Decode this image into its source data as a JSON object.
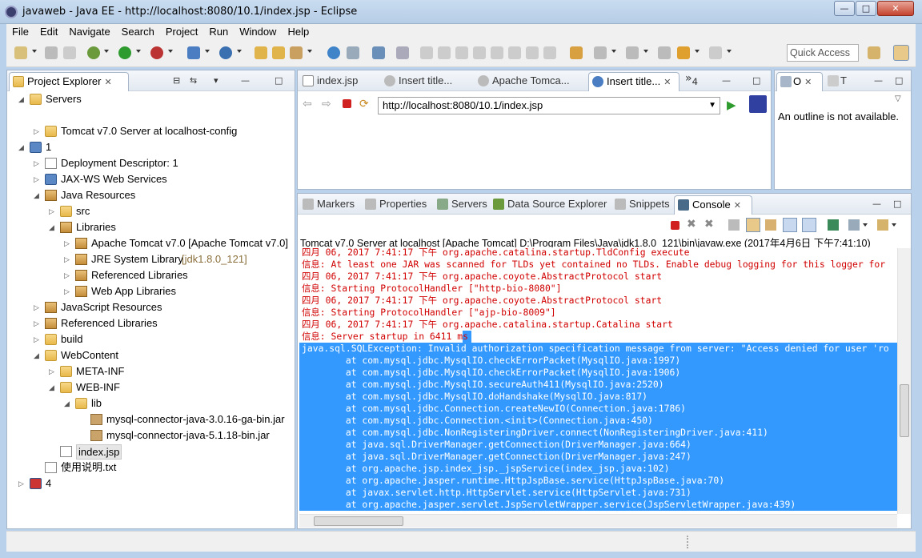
{
  "window": {
    "title": "javaweb - Java EE - http://localhost:8080/10.1/index.jsp - Eclipse",
    "min_label": "—",
    "max_label": "□",
    "close_label": "✕"
  },
  "menubar": [
    "File",
    "Edit",
    "Navigate",
    "Search",
    "Project",
    "Run",
    "Window",
    "Help"
  ],
  "toolbar": {
    "quick_access_placeholder": "Quick Access"
  },
  "project_explorer": {
    "tab_label": "Project Explorer",
    "tree": [
      {
        "label": "Servers",
        "indent": 0,
        "expanded": true,
        "icon": "folder-icon"
      },
      {
        "label": "",
        "indent": 1,
        "expanded": null,
        "icon": ""
      },
      {
        "label": "Tomcat v7.0 Server at localhost-config",
        "indent": 1,
        "expanded": false,
        "icon": "folder-icon"
      },
      {
        "label": "1",
        "indent": 0,
        "expanded": true,
        "icon": "project-icon"
      },
      {
        "label": "Deployment Descriptor: 1",
        "indent": 1,
        "expanded": false,
        "icon": "descriptor-icon"
      },
      {
        "label": "JAX-WS Web Services",
        "indent": 1,
        "expanded": false,
        "icon": "webservice-icon"
      },
      {
        "label": "Java Resources",
        "indent": 1,
        "expanded": true,
        "icon": "java-resources-icon"
      },
      {
        "label": "src",
        "indent": 2,
        "expanded": false,
        "icon": "package-folder-icon"
      },
      {
        "label": "Libraries",
        "indent": 2,
        "expanded": true,
        "icon": "libraries-icon"
      },
      {
        "label": "Apache Tomcat v7.0 [Apache Tomcat v7.0]",
        "indent": 3,
        "expanded": false,
        "icon": "library-icon"
      },
      {
        "label": "JRE System Library ",
        "suffix": "[jdk1.8.0_121]",
        "indent": 3,
        "expanded": false,
        "icon": "library-icon"
      },
      {
        "label": "Referenced Libraries",
        "indent": 3,
        "expanded": false,
        "icon": "library-icon"
      },
      {
        "label": "Web App Libraries",
        "indent": 3,
        "expanded": false,
        "icon": "library-icon"
      },
      {
        "label": "JavaScript Resources",
        "indent": 1,
        "expanded": false,
        "icon": "js-resources-icon"
      },
      {
        "label": "Referenced Libraries",
        "indent": 1,
        "expanded": false,
        "icon": "library-icon"
      },
      {
        "label": "build",
        "indent": 1,
        "expanded": false,
        "icon": "folder-icon"
      },
      {
        "label": "WebContent",
        "indent": 1,
        "expanded": true,
        "icon": "folder-icon"
      },
      {
        "label": "META-INF",
        "indent": 2,
        "expanded": false,
        "icon": "folder-icon"
      },
      {
        "label": "WEB-INF",
        "indent": 2,
        "expanded": true,
        "icon": "folder-icon"
      },
      {
        "label": "lib",
        "indent": 3,
        "expanded": true,
        "icon": "folder-icon"
      },
      {
        "label": "mysql-connector-java-3.0.16-ga-bin.jar",
        "indent": 4,
        "expanded": null,
        "icon": "jar-icon"
      },
      {
        "label": "mysql-connector-java-5.1.18-bin.jar",
        "indent": 4,
        "expanded": null,
        "icon": "jar-icon"
      },
      {
        "label": "index.jsp",
        "indent": 2,
        "expanded": null,
        "icon": "jsp-file-icon",
        "selected": true
      },
      {
        "label": "使用说明.txt",
        "indent": 1,
        "expanded": null,
        "icon": "text-file-icon"
      },
      {
        "label": "4",
        "indent": 0,
        "expanded": false,
        "icon": "project-error-icon"
      }
    ]
  },
  "editor": {
    "tabs": [
      {
        "label": "index.jsp",
        "active": false
      },
      {
        "label": "Insert title...",
        "active": false
      },
      {
        "label": "Apache Tomca...",
        "active": false
      },
      {
        "label": "Insert title...",
        "active": true
      }
    ],
    "overflow_label": "»",
    "overflow_count": "4",
    "url": "http://localhost:8080/10.1/index.jsp"
  },
  "outline": {
    "tab_label": "O",
    "tab2_label": "T",
    "message": "An outline is not available."
  },
  "bottom_panel": {
    "tabs": [
      "Markers",
      "Properties",
      "Servers",
      "Data Source Explorer",
      "Snippets",
      "Console"
    ],
    "active_tab": "Console",
    "console_header": "Tomcat v7.0 Server at localhost [Apache Tomcat] D:\\Program Files\\Java\\jdk1.8.0_121\\bin\\javaw.exe (2017年4月6日 下午7:41:10)",
    "lines": [
      {
        "text": "四月 06, 2017 7:41:17 下午 org.apache.catalina.startup.TldConfig execute",
        "selected": false
      },
      {
        "text": "信息: At least one JAR was scanned for TLDs yet contained no TLDs. Enable debug logging for this logger for",
        "selected": false
      },
      {
        "text": "四月 06, 2017 7:41:17 下午 org.apache.coyote.AbstractProtocol start",
        "selected": false
      },
      {
        "text": "信息: Starting ProtocolHandler [\"http-bio-8080\"]",
        "selected": false
      },
      {
        "text": "四月 06, 2017 7:41:17 下午 org.apache.coyote.AbstractProtocol start",
        "selected": false
      },
      {
        "text": "信息: Starting ProtocolHandler [\"ajp-bio-8009\"]",
        "selected": false
      },
      {
        "text": "四月 06, 2017 7:41:17 下午 org.apache.catalina.startup.Catalina start",
        "selected": false
      },
      {
        "text": "信息: Server startup in 6411 ms",
        "selected": false,
        "partial": true
      },
      {
        "text": "java.sql.SQLException: Invalid authorization specification message from server: \"Access denied for user 'ro",
        "selected": true
      },
      {
        "text": "        at com.mysql.jdbc.MysqlIO.checkErrorPacket(MysqlIO.java:1997)",
        "selected": true
      },
      {
        "text": "        at com.mysql.jdbc.MysqlIO.checkErrorPacket(MysqlIO.java:1906)",
        "selected": true
      },
      {
        "text": "        at com.mysql.jdbc.MysqlIO.secureAuth411(MysqlIO.java:2520)",
        "selected": true
      },
      {
        "text": "        at com.mysql.jdbc.MysqlIO.doHandshake(MysqlIO.java:817)",
        "selected": true
      },
      {
        "text": "        at com.mysql.jdbc.Connection.createNewIO(Connection.java:1786)",
        "selected": true
      },
      {
        "text": "        at com.mysql.jdbc.Connection.<init>(Connection.java:450)",
        "selected": true
      },
      {
        "text": "        at com.mysql.jdbc.NonRegisteringDriver.connect(NonRegisteringDriver.java:411)",
        "selected": true
      },
      {
        "text": "        at java.sql.DriverManager.getConnection(DriverManager.java:664)",
        "selected": true
      },
      {
        "text": "        at java.sql.DriverManager.getConnection(DriverManager.java:247)",
        "selected": true
      },
      {
        "text": "        at org.apache.jsp.index_jsp._jspService(index_jsp.java:102)",
        "selected": true
      },
      {
        "text": "        at org.apache.jasper.runtime.HttpJspBase.service(HttpJspBase.java:70)",
        "selected": true
      },
      {
        "text": "        at javax.servlet.http.HttpServlet.service(HttpServlet.java:731)",
        "selected": true
      },
      {
        "text": "        at org.apache.jasper.servlet.JspServletWrapper.service(JspServletWrapper.java:439)",
        "selected": true
      }
    ]
  },
  "colors": {
    "accent": "#3399ff",
    "console_error": "#d10000",
    "chrome_bg": "#b9d1ea"
  }
}
